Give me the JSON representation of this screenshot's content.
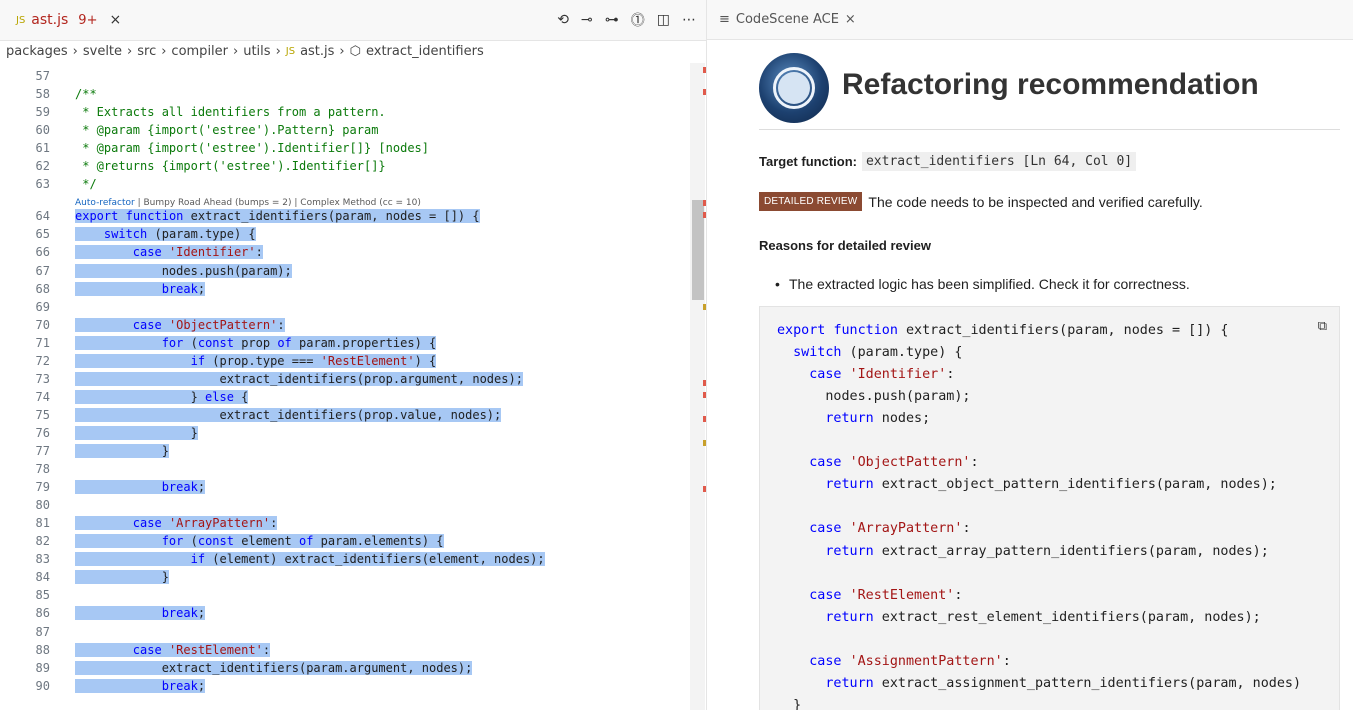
{
  "editor_tab": {
    "lang": "JS",
    "filename": "ast.js",
    "problems": "9+",
    "close": "×"
  },
  "editor_actions": [
    "⟲",
    "⊸",
    "⊶",
    "⓵",
    "◫",
    "⋯"
  ],
  "breadcrumb": [
    "packages",
    "svelte",
    "src",
    "compiler",
    "utils",
    "ast.js",
    "extract_identifiers"
  ],
  "code_lens": {
    "auto": "Auto-refactor",
    "rest": " | Bumpy Road Ahead (bumps = 2) | Complex Method (cc = 10)"
  },
  "code_lines": [
    {
      "n": "57",
      "t": ""
    },
    {
      "n": "58",
      "t": "/**"
    },
    {
      "n": "59",
      "t": " * Extracts all identifiers from a pattern."
    },
    {
      "n": "60",
      "t": " * @param {import('estree').Pattern} param"
    },
    {
      "n": "61",
      "t": " * @param {import('estree').Identifier[]} [nodes]"
    },
    {
      "n": "62",
      "t": " * @returns {import('estree').Identifier[]}"
    },
    {
      "n": "63",
      "t": " */"
    },
    {
      "n": "64",
      "t": "export function extract_identifiers(param, nodes = []) {"
    },
    {
      "n": "65",
      "t": "    switch (param.type) {"
    },
    {
      "n": "66",
      "t": "        case 'Identifier':"
    },
    {
      "n": "67",
      "t": "            nodes.push(param);"
    },
    {
      "n": "68",
      "t": "            break;"
    },
    {
      "n": "69",
      "t": ""
    },
    {
      "n": "70",
      "t": "        case 'ObjectPattern':"
    },
    {
      "n": "71",
      "t": "            for (const prop of param.properties) {"
    },
    {
      "n": "72",
      "t": "                if (prop.type === 'RestElement') {"
    },
    {
      "n": "73",
      "t": "                    extract_identifiers(prop.argument, nodes);"
    },
    {
      "n": "74",
      "t": "                } else {"
    },
    {
      "n": "75",
      "t": "                    extract_identifiers(prop.value, nodes);"
    },
    {
      "n": "76",
      "t": "                }"
    },
    {
      "n": "77",
      "t": "            }"
    },
    {
      "n": "78",
      "t": ""
    },
    {
      "n": "79",
      "t": "            break;"
    },
    {
      "n": "80",
      "t": ""
    },
    {
      "n": "81",
      "t": "        case 'ArrayPattern':"
    },
    {
      "n": "82",
      "t": "            for (const element of param.elements) {"
    },
    {
      "n": "83",
      "t": "                if (element) extract_identifiers(element, nodes);"
    },
    {
      "n": "84",
      "t": "            }"
    },
    {
      "n": "85",
      "t": ""
    },
    {
      "n": "86",
      "t": "            break;"
    },
    {
      "n": "87",
      "t": ""
    },
    {
      "n": "88",
      "t": "        case 'RestElement':"
    },
    {
      "n": "89",
      "t": "            extract_identifiers(param.argument, nodes);"
    },
    {
      "n": "90",
      "t": "            break;"
    }
  ],
  "panel_tab": {
    "icon": "≡",
    "title": "CodeScene ACE",
    "close": "×"
  },
  "panel": {
    "heading": "Refactoring recommendation",
    "target_label": "Target function:",
    "target_value": "extract_identifiers [Ln 64, Col 0]",
    "review_tag": "DETAILED REVIEW",
    "review_text": "The code needs to be inspected and verified carefully.",
    "reasons_heading": "Reasons for detailed review",
    "reason": "The extracted logic has been simplified. Check it for correctness.",
    "code": [
      "export function extract_identifiers(param, nodes = []) {",
      "  switch (param.type) {",
      "    case 'Identifier':",
      "      nodes.push(param);",
      "      return nodes;",
      "",
      "    case 'ObjectPattern':",
      "      return extract_object_pattern_identifiers(param, nodes);",
      "",
      "    case 'ArrayPattern':",
      "      return extract_array_pattern_identifiers(param, nodes);",
      "",
      "    case 'RestElement':",
      "      return extract_rest_element_identifiers(param, nodes);",
      "",
      "    case 'AssignmentPattern':",
      "      return extract_assignment_pattern_identifiers(param, nodes)",
      "  }",
      "}"
    ]
  },
  "colors": {
    "selection": "#a7c8f4",
    "keyword": "#0000ff",
    "string": "#a31515",
    "comment": "#0b7a0b",
    "tag_bg": "#8b4a32",
    "error": "#b3261e"
  }
}
